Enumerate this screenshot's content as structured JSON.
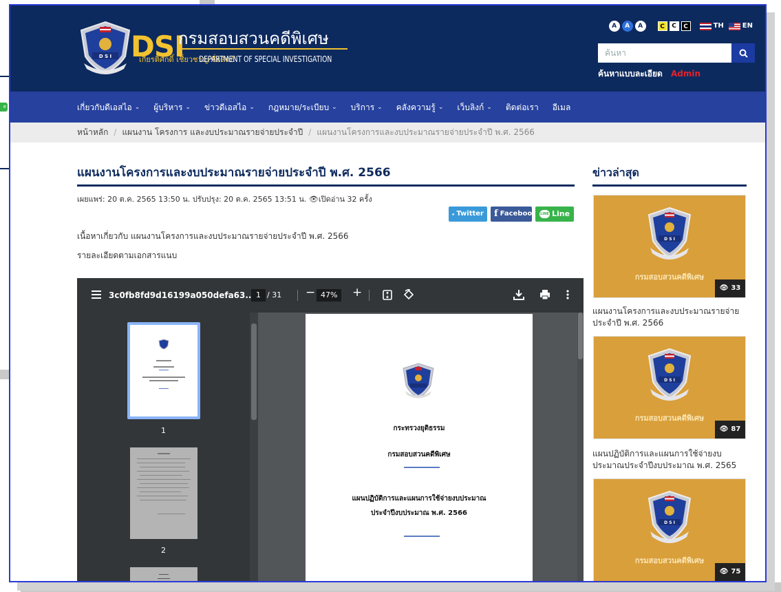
{
  "site": {
    "logo_abbr": "DSI",
    "logo_th": "กรมสอบสวนคดีพิเศษ",
    "logo_motto": "เกียรติศักดิ์ เชี่ยวชาญ ซื่อสัตย์",
    "logo_en": "DEPARTMENT OF SPECIAL INVESTIGATION",
    "emblem_text": "D S I",
    "colors": {
      "header": "#0d2a5e",
      "nav": "#26419e",
      "gold": "#f2c230",
      "admin": "#e2232a"
    }
  },
  "accessibility": {
    "font_sizes": [
      "A",
      "A",
      "A"
    ],
    "contrast": [
      "C",
      "C",
      "C"
    ],
    "lang_th": "TH",
    "lang_en": "EN"
  },
  "search": {
    "placeholder": "ค้นหา",
    "advanced_label": "ค้นหาแบบละเอียด",
    "admin_label": "Admin"
  },
  "nav": [
    {
      "label": "เกี่ยวกับดีเอสไอ",
      "has_caret": true
    },
    {
      "label": "ผู้บริหาร",
      "has_caret": true
    },
    {
      "label": "ข่าวดีเอสไอ",
      "has_caret": true
    },
    {
      "label": "กฎหมาย/ระเบียบ",
      "has_caret": true
    },
    {
      "label": "บริการ",
      "has_caret": true
    },
    {
      "label": "คลังความรู้",
      "has_caret": true
    },
    {
      "label": "เว็บลิงก์",
      "has_caret": true
    },
    {
      "label": "ติดต่อเรา",
      "has_caret": false
    },
    {
      "label": "อีเมล",
      "has_caret": false
    }
  ],
  "breadcrumb": {
    "home": "หน้าหลัก",
    "section": "แผนงาน โครงการ และงบประมาณรายจ่ายประจำปี",
    "current": "แผนงานโครงการและงบประมาณรายจ่ายประจำปี พ.ศ. 2566"
  },
  "article": {
    "title": "แผนงานโครงการและงบประมาณรายจ่ายประจำปี พ.ศ. 2566",
    "published_label": "เผยแพร่:",
    "published": "20 ต.ค. 2565 13:50 น.",
    "updated_label": "ปรับปรุง:",
    "updated": "20 ต.ค. 2565 13:51 น.",
    "views_text": "เปิดอ่าน 32 ครั้ง",
    "body_line1": "เนื้อหาเกี่ยวกับ แผนงานโครงการและงบประมาณรายจ่ายประจำปี พ.ศ. 2566",
    "body_line2": "รายละเอียดตามเอกสารแนบ"
  },
  "share": {
    "twitter": "Twitter",
    "facebook": "Facebook",
    "line": "Line"
  },
  "pdf": {
    "filename": "3c0fb8fd9d16199a050defa63...",
    "page_current": "1",
    "page_total": "/ 31",
    "zoom": "47%",
    "thumb_labels": [
      "1",
      "2"
    ],
    "page_lines": [
      "กระทรวงยุติธรรม",
      "กรมสอบสวนคดีพิเศษ",
      "แผนปฏิบัติการและแผนการใช้จ่ายงบประมาณ",
      "ประจำปีงบประมาณ พ.ศ. 2566"
    ]
  },
  "sidebar": {
    "title": "ข่าวล่าสุด",
    "cards": [
      {
        "caption": "กรมสอบสวนคดีพิเศษ",
        "views": "33",
        "title": "แผนงานโครงการและงบประมาณรายจ่ายประจำปี พ.ศ. 2566"
      },
      {
        "caption": "กรมสอบสวนคดีพิเศษ",
        "views": "87",
        "title": "แผนปฏิบัติการและแผนการใช้จ่ายงบประมาณประจำปีงบประมาณ พ.ศ. 2565"
      },
      {
        "caption": "กรมสอบสวนคดีพิเศษ",
        "views": "75",
        "title": ""
      }
    ]
  }
}
